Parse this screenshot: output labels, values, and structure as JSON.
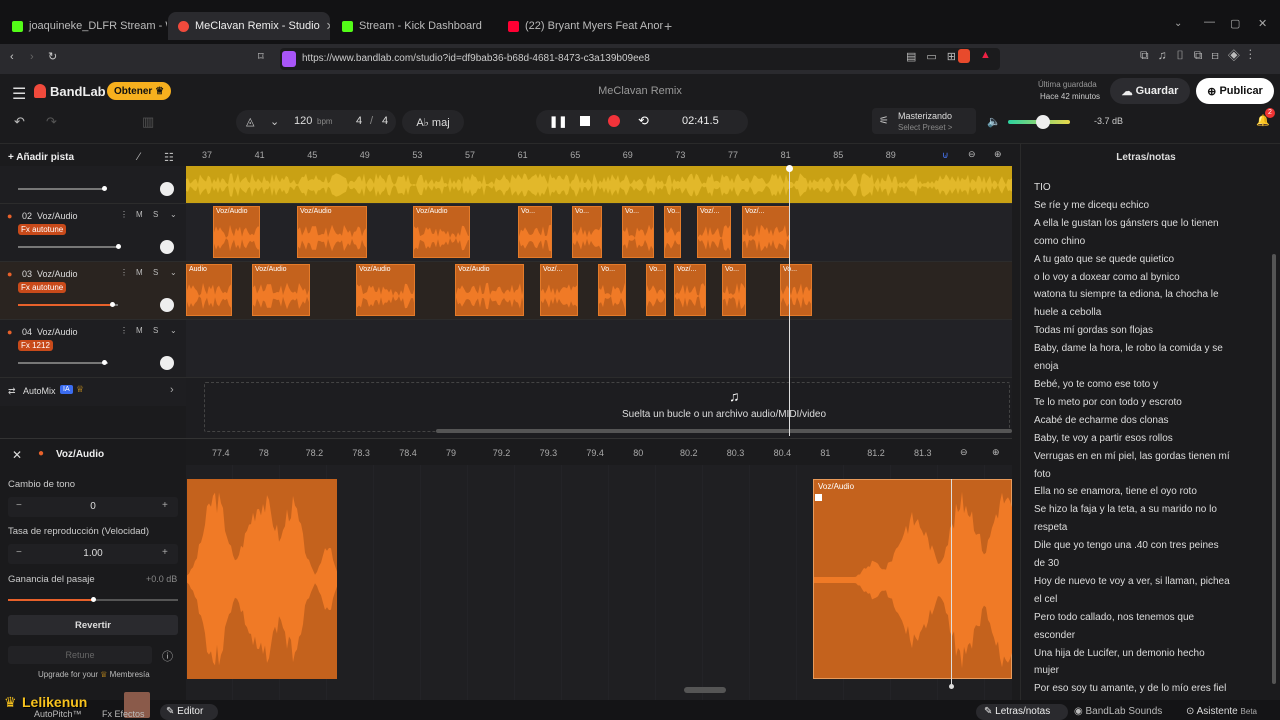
{
  "browser": {
    "tabs": [
      {
        "label": "joaquineke_DLFR Stream - Watch Liv",
        "color": "#53fc18"
      },
      {
        "label": "MeClavan Remix - Studio",
        "color": "#f04a3c",
        "active": true
      },
      {
        "label": "Stream - Kick Dashboard",
        "color": "#53fc18"
      },
      {
        "label": "(22) Bryant Myers Feat Anonimus, An",
        "color": "#ff0033"
      }
    ],
    "url": "https://www.bandlab.com/studio?id=df9bab36-b68d-4681-8473-c3a139b09ee8"
  },
  "app": {
    "brand": "BandLab",
    "obtain": "Obtener",
    "title": "MeClavan Remix",
    "last_saved_label": "Última guardada",
    "last_saved_time": "Hace 42 minutos",
    "save": "Guardar",
    "publish": "Publicar",
    "notif_count": "2"
  },
  "toolbar": {
    "tempo": "120",
    "tempo_unit": "bpm",
    "timesig_num": "4",
    "timesig_sep": "/",
    "timesig_den": "4",
    "key": "A♭ maj",
    "time": "02:41.5",
    "mastering_label": "Masterizando",
    "mastering_preset": "Select Preset >",
    "volume": "-3.7 dB",
    "accent": "#e8612a"
  },
  "ruler": {
    "ticks": [
      "37",
      "41",
      "45",
      "49",
      "53",
      "57",
      "61",
      "65",
      "69",
      "73",
      "77",
      "81",
      "85",
      "89"
    ]
  },
  "tracks": {
    "add_label": "Añadir pista",
    "items": [
      {
        "num": "02",
        "name": "Voz/Audio",
        "fx": "Fx autotune"
      },
      {
        "num": "03",
        "name": "Voz/Audio",
        "fx": "Fx autotune"
      },
      {
        "num": "04",
        "name": "Voz/Audio",
        "fx": "Fx 1212"
      }
    ],
    "m": "M",
    "s": "S",
    "clip_label": "Voz/Audio",
    "clip_short": "Vo...",
    "clip_mid": "Voz/...",
    "clip_first": "Audio",
    "automix": "AutoMix",
    "automix_badge": "IA",
    "drop_hint": "Suelta un bucle o un archivo audio/MIDI/video"
  },
  "editor": {
    "title": "Voz/Audio",
    "pitch_label": "Cambio de tono",
    "pitch_value": "0",
    "rate_label": "Tasa de reproducción (Velocidad)",
    "rate_value": "1.00",
    "gain_label": "Ganancia del pasaje",
    "gain_value": "+0.0 dB",
    "revert": "Revertir",
    "retune": "Retune",
    "upgrade": "Upgrade for your",
    "membership": "Membresía",
    "ruler": [
      "77.4",
      "78",
      "78.2",
      "78.3",
      "78.4",
      "79",
      "79.2",
      "79.3",
      "79.4",
      "80",
      "80.2",
      "80.3",
      "80.4",
      "81",
      "81.2",
      "81.3"
    ],
    "clip_label": "Voz/Audio"
  },
  "lyrics": {
    "title": "Letras/notas",
    "lines": [
      "TIO",
      "Se ríe y me dicequ echico",
      "A ella le gustan los gánsters que lo tienen",
      "como chino",
      "A tu gato que se quede quietico",
      "o lo voy a doxear como al bynico",
      "watona tu siempre ta ediona, la chocha le",
      "huele a cebolla",
      "Todas mí gordas son flojas",
      "Baby, dame la hora, le robo la comida y se",
      "enoja",
      "Bebé, yo te como ese toto y",
      "Te lo meto por con todo y escroto",
      "Acabé de echarme dos clonas",
      "Baby, te voy a partir esos rollos",
      "Verrugas en en mí piel, las gordas tienen mí",
      "foto",
      "Ella no se enamora, tiene el oyo roto",
      "Se hizo la faja y la teta, a su marido no lo",
      "respeta",
      "Dile que yo tengo una .40 con tres peines",
      "de 30",
      "Hoy de nuevo te voy a ver, si llaman, pichea",
      "el cel",
      "Pero todo callado, nos tenemos que",
      "esconder",
      "Una hija de Lucifer, un demonio hecho",
      "mujer",
      "Por eso soy tu amante, y de lo mío eres fiel"
    ]
  },
  "bottom": {
    "streamer": "Lelikenun",
    "autopitch": "AutoPitch™",
    "effects": "Efectos",
    "editor": "Editor",
    "lyrics_tab": "Letras/notas",
    "sounds_tab": "BandLab Sounds",
    "assistant_tab": "Asistente",
    "beta": "Beta"
  }
}
